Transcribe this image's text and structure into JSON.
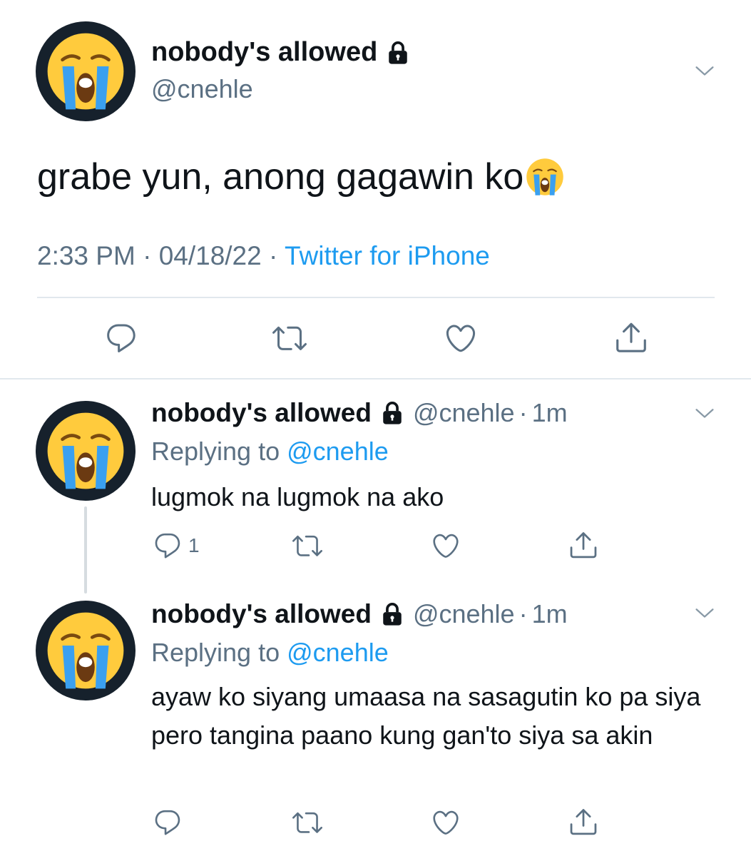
{
  "main_tweet": {
    "display_name": "nobody's allowed",
    "handle": "@cnehle",
    "text": "grabe yun, anong gagawin ko",
    "time": "2:33 PM",
    "date": "04/18/22",
    "source": "Twitter for iPhone",
    "separator": "·"
  },
  "replies": [
    {
      "display_name": "nobody's allowed",
      "handle": "@cnehle",
      "separator": "·",
      "time": "1m",
      "replying_prefix": "Replying to ",
      "replying_to": "@cnehle",
      "text": "lugmok na lugmok na ako",
      "reply_count": "1"
    },
    {
      "display_name": "nobody's allowed",
      "handle": "@cnehle",
      "separator": "·",
      "time": "1m",
      "replying_prefix": "Replying to ",
      "replying_to": "@cnehle",
      "text": "ayaw ko siyang umaasa na sasagutin ko pa siya pero tangina paano kung gan'to siya sa akin"
    }
  ],
  "icons": {
    "avatar": "loudly-crying-face-icon",
    "emoji": "loudly-crying-face-icon",
    "lock": "lock-icon",
    "menu": "chevron-down-icon",
    "reply": "reply-icon",
    "retweet": "retweet-icon",
    "like": "heart-icon",
    "share": "share-icon"
  },
  "colors": {
    "link": "#1d9bf0",
    "secondary_text": "#5b7083",
    "primary_text": "#0f1419",
    "avatar_bg": "#16212c",
    "divider": "#e1e8ed"
  }
}
